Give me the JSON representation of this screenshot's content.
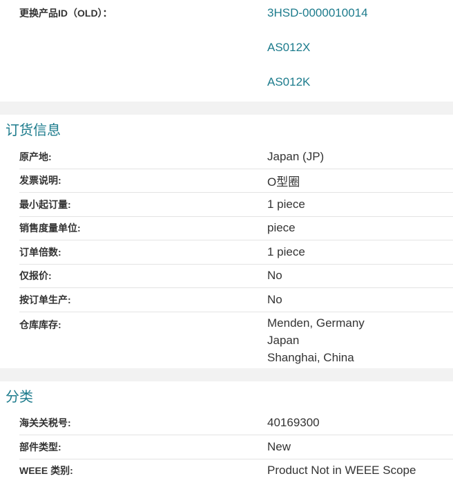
{
  "replacement": {
    "label": "更换产品ID（OLD）：",
    "ids": [
      "3HSD-0000010014",
      "AS012X",
      "AS012K"
    ]
  },
  "ordering": {
    "title": "订货信息",
    "rows": [
      {
        "label": "原产地:",
        "value": "Japan (JP)"
      },
      {
        "label": "发票说明:",
        "value": "O型圈"
      },
      {
        "label": "最小起订量:",
        "value": "1 piece"
      },
      {
        "label": "销售度量单位:",
        "value": "piece"
      },
      {
        "label": "订单倍数:",
        "value": "1 piece"
      },
      {
        "label": "仅报价:",
        "value": "No"
      },
      {
        "label": "按订单生产:",
        "value": "No"
      }
    ],
    "warehouse": {
      "label": "仓库库存:",
      "values": [
        "Menden, Germany",
        "Japan",
        "Shanghai, China"
      ]
    }
  },
  "classification": {
    "title": "分类",
    "rows": [
      {
        "label": "海关关税号:",
        "value": "40169300"
      },
      {
        "label": "部件类型:",
        "value": "New"
      },
      {
        "label": "WEEE 类别:",
        "value": "Product Not in WEEE Scope"
      }
    ]
  }
}
